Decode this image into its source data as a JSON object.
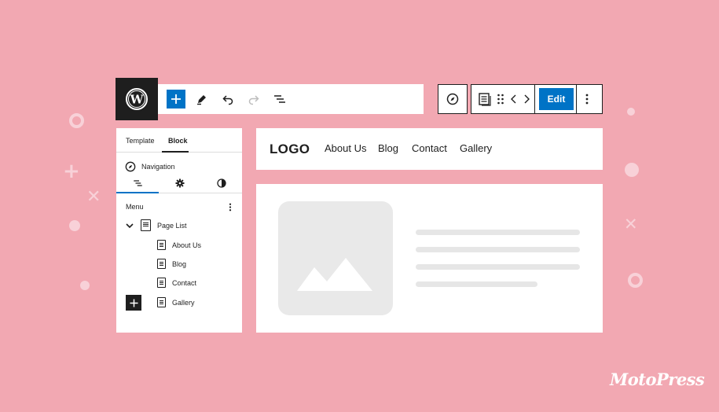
{
  "toolbar": {
    "edit_label": "Edit"
  },
  "sidebar": {
    "tabs": [
      "Template",
      "Block"
    ],
    "block_name": "Navigation",
    "menu_label": "Menu",
    "page_list_label": "Page List",
    "pages": [
      "About Us",
      "Blog",
      "Contact",
      "Gallery"
    ]
  },
  "preview": {
    "logo": "LOGO",
    "menu": [
      "About Us",
      "Blog",
      "Contact",
      "Gallery"
    ]
  },
  "brand": "MotoPress",
  "icons": {
    "wordpress": "wordpress-logo-icon",
    "add": "plus-icon",
    "pen": "pen-icon",
    "undo": "undo-icon",
    "redo": "redo-icon",
    "outline": "list-view-icon",
    "compass": "compass-icon",
    "page": "page-icon",
    "drag": "drag-handle-icon",
    "arrows": "move-arrows-icon",
    "more": "more-vertical-icon"
  },
  "colors": {
    "background": "#f2a8b2",
    "accent": "#0073c6",
    "dark": "#1e1e1e"
  }
}
